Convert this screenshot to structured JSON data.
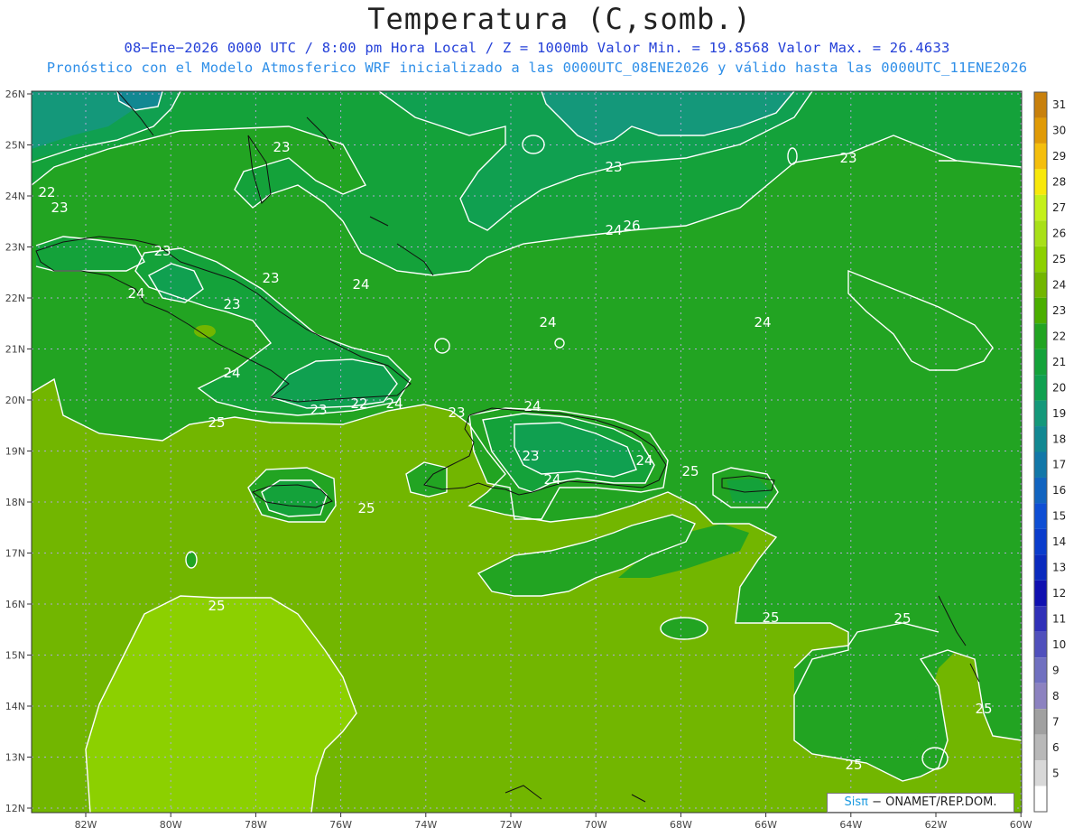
{
  "title": "Temperatura (C,somb.)",
  "subtitle_1": "08−Ene−2026  0000 UTC / 8:00 pm Hora Local / Z = 1000mb   Valor Min. = 19.8568  Valor Max. = 26.4633",
  "subtitle_2": "Pronóstico con el Modelo Atmosferico WRF inicializado a las 0000UTC_08ENE2026 y válido hasta las  0000UTC_11ENE2026",
  "credit": {
    "brand": "Sisπ",
    "rest": " − ONAMET/REP.DOM."
  },
  "axes": {
    "x_ticks": [
      "82W",
      "80W",
      "78W",
      "76W",
      "74W",
      "72W",
      "70W",
      "68W",
      "66W",
      "64W",
      "62W",
      "60W"
    ],
    "y_ticks": [
      "26N",
      "25N",
      "24N",
      "23N",
      "22N",
      "21N",
      "20N",
      "19N",
      "18N",
      "17N",
      "16N",
      "15N",
      "14N",
      "13N",
      "12N"
    ]
  },
  "colorbar": {
    "levels": [
      "31",
      "30",
      "29",
      "28",
      "27",
      "26",
      "25",
      "24",
      "23",
      "22",
      "21",
      "20",
      "19",
      "18",
      "17",
      "16",
      "15",
      "14",
      "13",
      "12",
      "11",
      "10",
      "9",
      "8",
      "7",
      "6",
      "5"
    ],
    "colors": [
      "#c8800c",
      "#e09a06",
      "#f4be0c",
      "#f8e80a",
      "#c4f01a",
      "#a8e018",
      "#8cd000",
      "#72b600",
      "#4aae00",
      "#22a422",
      "#14a23a",
      "#10a050",
      "#14987a",
      "#128892",
      "#1277a8",
      "#1164c0",
      "#0e4ed4",
      "#0a3ccc",
      "#0a2abe",
      "#1010b0",
      "#3030b8",
      "#5050bc",
      "#7070c0",
      "#8c82c0",
      "#a0a0a0",
      "#b8b8b8",
      "#d8d8d8",
      "#ffffff"
    ]
  },
  "contour_labels": [
    "22",
    "23",
    "23",
    "23",
    "23",
    "23",
    "23",
    "24",
    "24",
    "24",
    "24",
    "24",
    "24",
    "24",
    "23",
    "23",
    "23",
    "22",
    "24",
    "25",
    "25",
    "25",
    "24",
    "23",
    "24",
    "25",
    "25",
    "25",
    "26",
    "25",
    "25"
  ],
  "colors": {
    "c26": "#8cd000",
    "c25": "#72b600",
    "c24": "#22a422",
    "c23": "#14a23a",
    "c22": "#10a050",
    "c21": "#14987a",
    "c20": "#128892"
  }
}
